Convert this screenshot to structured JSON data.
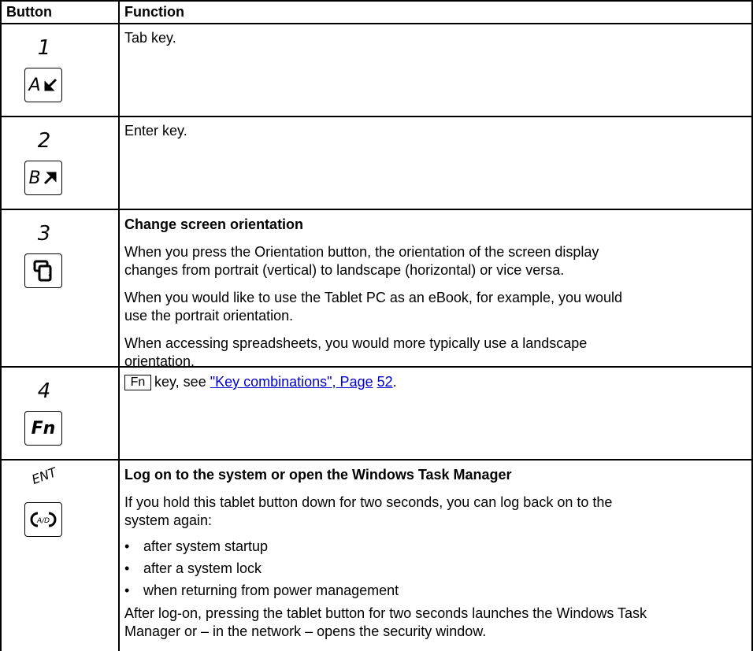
{
  "header": {
    "col_button": "Button",
    "col_function": "Function"
  },
  "rows": [
    {
      "number": "1",
      "key_letter": "A",
      "key_icon": "arrow-down-left-icon",
      "text": "Tab key."
    },
    {
      "number": "2",
      "key_letter": "B",
      "key_icon": "arrow-up-right-icon",
      "text": "Enter key."
    },
    {
      "number": "3",
      "key_icon": "rotate-screen-icon",
      "title": "Change screen orientation",
      "paragraphs": [
        "When you press the Orientation button, the orientation of the screen display",
        "changes from portrait (vertical) to landscape (horizontal) or vice versa.",
        "When you would like to use the Tablet PC as an eBook, for example, you would",
        "use the portrait orientation.",
        "When accessing spreadsheets, you would more typically use a landscape",
        "orientation."
      ]
    },
    {
      "number": "4",
      "key_label": "Fn",
      "fn_box": "Fn",
      "text_pre": " key, see ",
      "link_text": "\"Key combinations\", Page",
      "page_link": "52",
      "text_post": "."
    },
    {
      "number": "ENT",
      "key_icon": "ctrl-alt-del-icon",
      "key_symbol": "A/D",
      "title": "Log on to the system or open the Windows Task Manager",
      "intro": [
        "If you hold this tablet button down for two seconds, you can log back on to the",
        "system again:"
      ],
      "bullets": [
        "after system startup",
        "after a system lock",
        "when returning from power management"
      ],
      "outro": [
        "After log-on, pressing the tablet button for two seconds launches the Windows Task",
        "Manager or – in the network – opens the security window."
      ]
    }
  ]
}
